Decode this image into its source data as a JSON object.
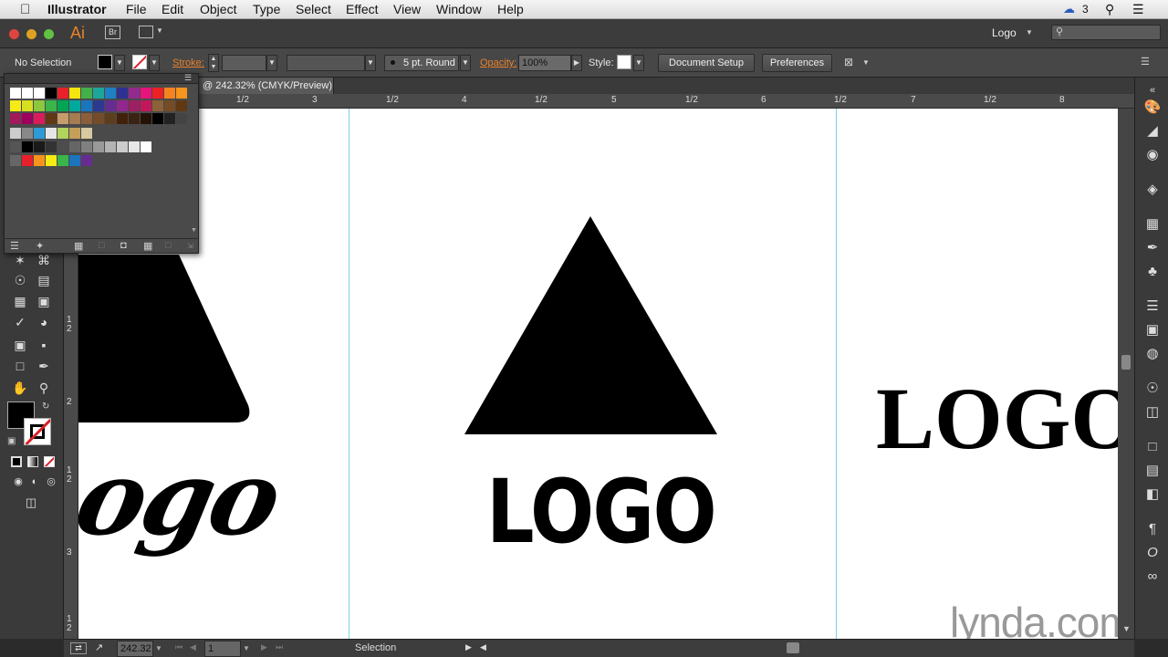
{
  "menubar": {
    "app_name": "Illustrator",
    "items": [
      "File",
      "Edit",
      "Object",
      "Type",
      "Select",
      "Effect",
      "View",
      "Window",
      "Help"
    ],
    "cc_count": "3"
  },
  "appbar": {
    "ai_label": "Ai",
    "br_label": "Br",
    "workspace": "Logo",
    "search_placeholder": ""
  },
  "control": {
    "selection": "No Selection",
    "stroke_label": "Stroke:",
    "brush": "5 pt. Round",
    "opacity_label": "Opacity:",
    "opacity_value": "100%",
    "style_label": "Style:",
    "document_setup": "Document Setup",
    "preferences": "Preferences"
  },
  "document": {
    "tab_title": "@ 242.32% (CMYK/Preview)"
  },
  "ruler": {
    "h_labels": [
      "1/2",
      "3",
      "1/2",
      "4",
      "1/2",
      "5",
      "1/2",
      "6",
      "1/2",
      "7",
      "1/2",
      "8"
    ],
    "v_labels": [
      "1",
      "2",
      "2",
      "1",
      "2",
      "3",
      "1",
      "2"
    ]
  },
  "artwork": {
    "center_wordmark": "LOGO",
    "right_wordmark": "LOGO",
    "left_script": "ogo"
  },
  "status": {
    "zoom": "242.32",
    "artboard": "1",
    "tool_name": "Selection"
  },
  "watermark": "lynda.com",
  "colors": {
    "accent_orange": "#e8822a",
    "guide_cyan": "#79d4e8",
    "ui_dark": "#3a3a3a"
  }
}
